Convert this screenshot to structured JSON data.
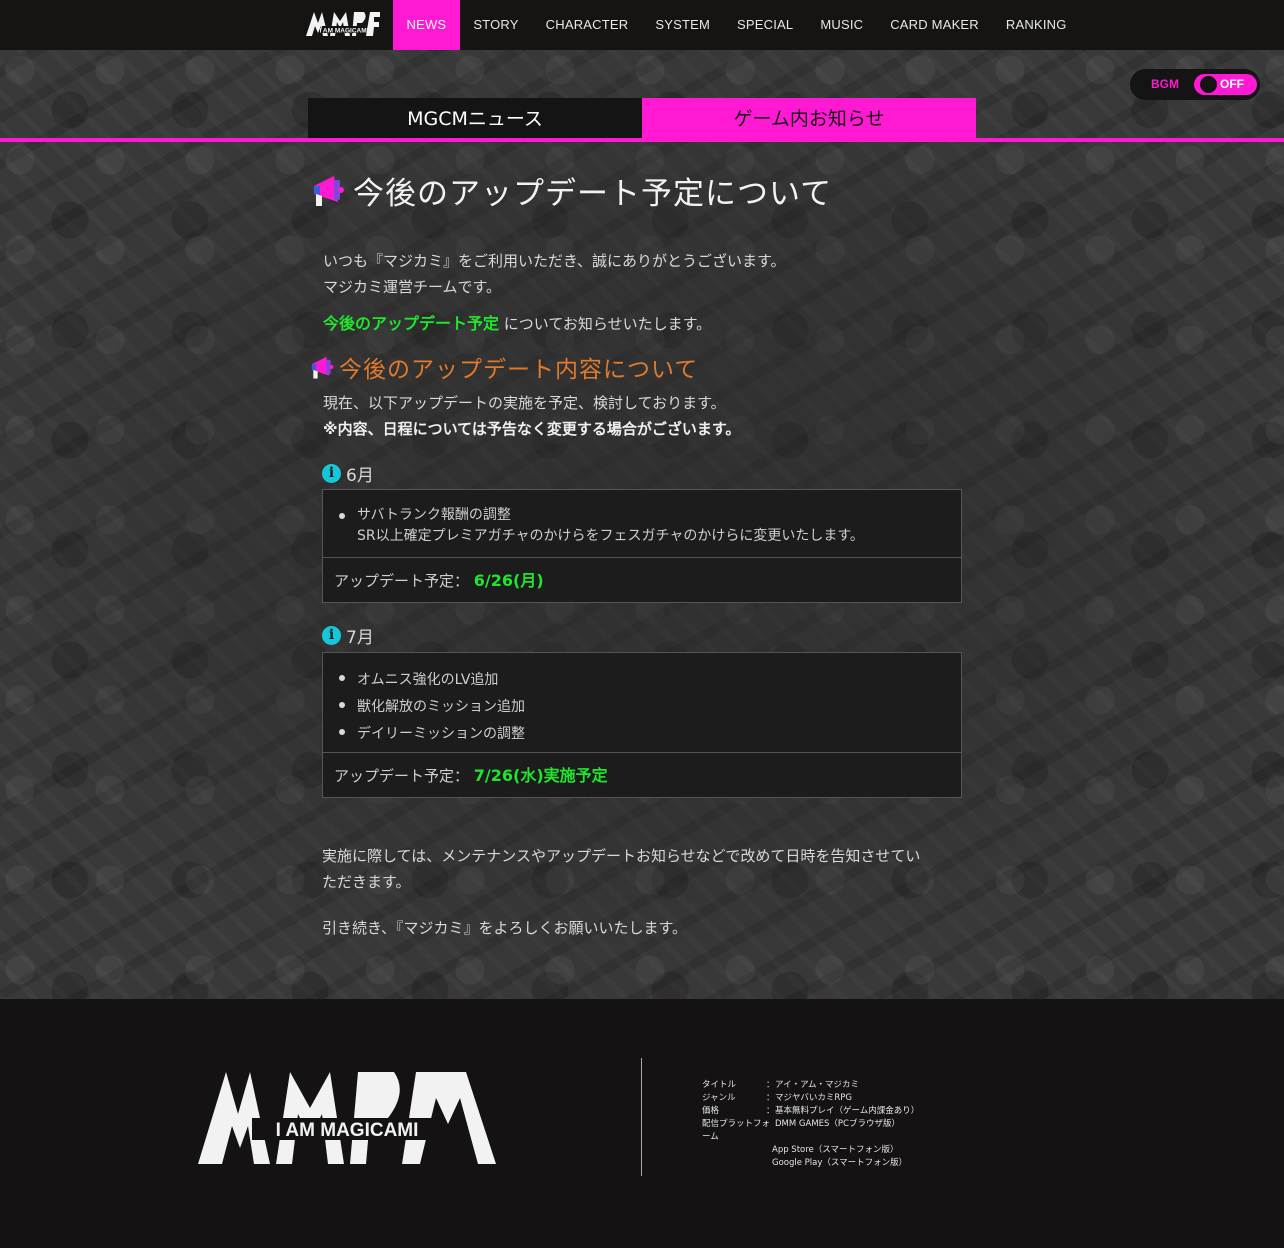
{
  "nav": {
    "logo_text": "I AM MAGICAMI",
    "items": [
      "NEWS",
      "STORY",
      "CHARACTER",
      "SYSTEM",
      "SPECIAL",
      "MUSIC",
      "CARD MAKER",
      "RANKING"
    ],
    "active": "NEWS"
  },
  "bgm": {
    "label": "BGM",
    "state": "OFF"
  },
  "tabs": {
    "news": "MGCMニュース",
    "game": "ゲーム内お知らせ",
    "active": "game"
  },
  "article": {
    "title": "今後のアップデート予定について",
    "intro_line1": "いつも『マジカミ』をご利用いただき、誠にありがとうございます。",
    "intro_line2": "マジカミ運営チームです。",
    "highlight": "今後のアップデート予定",
    "highlight_suffix": "についてお知らせいたします。",
    "section_title": "今後のアップデート内容について",
    "section_line1": "現在、以下アップデートの実施を予定、検討しております。",
    "section_line2": "※内容、日程については予告なく変更する場合がございます。",
    "months": [
      {
        "label": "6月",
        "items": [
          {
            "text": "サバトランク報酬の調整",
            "sub": "SR以上確定プレミアガチャのかけらをフェスガチャのかけらに変更いたします。"
          }
        ],
        "schedule_label": "アップデート予定：",
        "schedule_value": "6/26(月)"
      },
      {
        "label": "7月",
        "items": [
          {
            "text": "オムニス強化のLV追加"
          },
          {
            "text": "獣化解放のミッション追加"
          },
          {
            "text": "デイリーミッションの調整"
          }
        ],
        "schedule_label": "アップデート予定：",
        "schedule_value": "7/26(水)実施予定"
      }
    ],
    "closing_line1": "実施に際しては、メンテナンスやアップデートお知らせなどで改めて日時を告知させてい",
    "closing_line2": "ただきます。",
    "closing_line3": "引き続き、『マジカミ』をよろしくお願いいたします。"
  },
  "footer": {
    "logo_text": "I AM MAGICAMI",
    "info": [
      {
        "key": "タイトル",
        "value": "アイ・アム・マジカミ"
      },
      {
        "key": "ジャンル",
        "value": "マジヤバいカミRPG"
      },
      {
        "key": "価格",
        "value": "基本無料プレイ（ゲーム内課金あり）"
      },
      {
        "key": "配信プラットフォーム",
        "value": "DMM GAMES（PCブラウザ版）"
      },
      {
        "key": "",
        "value": "App Store（スマートフォン版）"
      },
      {
        "key": "",
        "value": "Google Play（スマートフォン版）"
      }
    ]
  },
  "colors": {
    "accent": "#ff19d3",
    "green": "#1fe52c",
    "section": "#e07a2e",
    "info": "#16c7d9"
  }
}
